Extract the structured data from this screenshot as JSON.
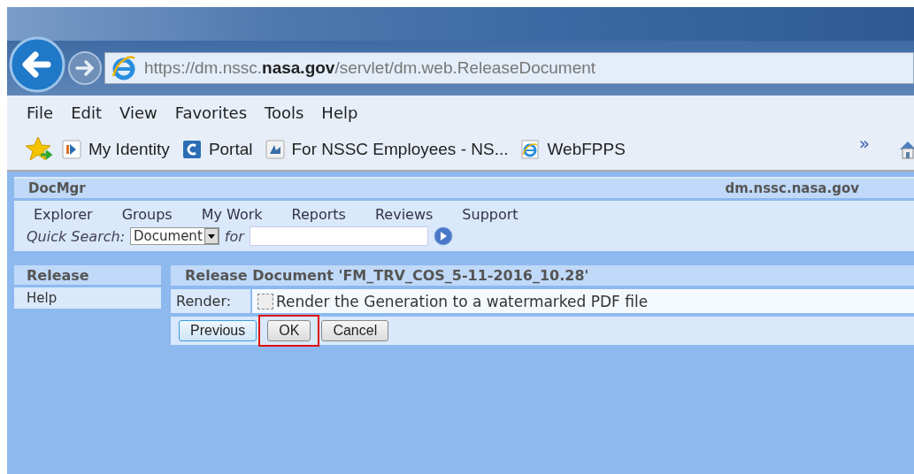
{
  "browser": {
    "url": "https://dm.nssc.**nasa.gov**/servlet/dm.web.ReleaseDocument",
    "menu": [
      "File",
      "Edit",
      "View",
      "Favorites",
      "Tools",
      "Help"
    ],
    "favorites": [
      {
        "label": "My Identity",
        "kind": "identity"
      },
      {
        "label": "Portal",
        "kind": "portal"
      },
      {
        "label": "For NSSC Employees - NS...",
        "kind": "page"
      },
      {
        "label": "WebFPPS",
        "kind": "ie"
      }
    ],
    "overflow": "»"
  },
  "app": {
    "title": "DocMgr",
    "host": "dm.nssc.nasa.gov",
    "nav": [
      "Explorer",
      "Groups",
      "My Work",
      "Reports",
      "Reviews",
      "Support"
    ],
    "quick_search": {
      "label": "Quick Search:",
      "scope": "Document",
      "for": "for"
    }
  },
  "sidebar": {
    "title": "Release",
    "items": [
      "Help"
    ]
  },
  "panel": {
    "title": "Release Document 'FM_TRV_COS_5-11-2016_10.28'",
    "field_label": "Render:",
    "checkbox": {
      "label": "Render the Generation to a watermarked PDF file",
      "checked": false
    },
    "buttons": [
      {
        "label": "Previous",
        "selected": true,
        "highlighted": false
      },
      {
        "label": "OK",
        "selected": false,
        "highlighted": true
      },
      {
        "label": "Cancel",
        "selected": false,
        "highlighted": false
      }
    ]
  }
}
